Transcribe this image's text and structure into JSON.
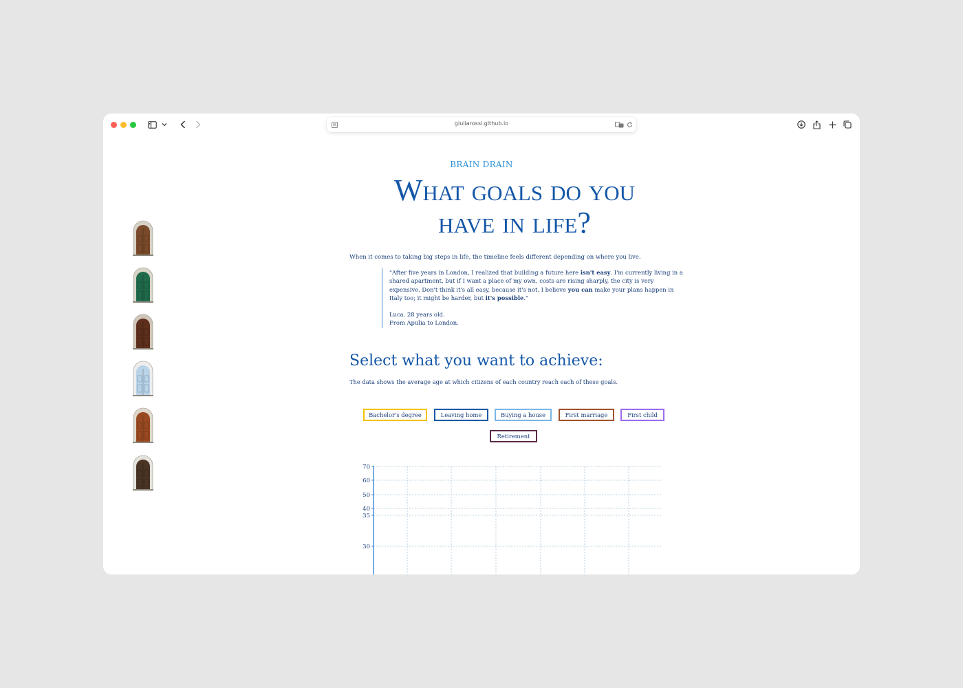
{
  "browser": {
    "url": "giuliarossi.github.io",
    "icons": [
      "sidebar-icon",
      "chevron-down-icon",
      "back-icon",
      "forward-icon",
      "reader-icon",
      "translate-icon",
      "reload-icon",
      "download-icon",
      "share-icon",
      "new-tab-icon",
      "tabs-overview-icon"
    ]
  },
  "page": {
    "kicker": "BRAIN DRAIN",
    "title_line1": "What goals do you",
    "title_line2": "have in life?",
    "intro": "When it comes to taking big steps in life, the timeline feels different depending on where you live.",
    "quote": {
      "t1": "\"After five years in London, I realized that building a future here ",
      "b1": "isn't easy",
      "t2": ". I'm currently living in a shared apartment, but if I want a place of my own, costs are rising sharply, the city is very expensive. Don't think it's all easy, because it's not. I believe ",
      "b2": "you can",
      "t3": " make your plans happen in Italy too; it might be harder, but ",
      "b3": "it's possible",
      "t4": ".\"",
      "attrib_name": "Luca. 28 years old.",
      "attrib_origin": "From Apulia to London."
    },
    "section_title": "Select what you want to achieve:",
    "section_sub": "The data shows the average age at which citizens of each country reach each of these goals."
  },
  "goals": [
    {
      "label": "Bachelor's degree",
      "color": "#f2c300"
    },
    {
      "label": "Leaving home",
      "color": "#1a5aa6"
    },
    {
      "label": "Buying a house",
      "color": "#7ab6e6"
    },
    {
      "label": "First marriage",
      "color": "#a0522d"
    },
    {
      "label": "First child",
      "color": "#9b6cf0"
    },
    {
      "label": "Retirement",
      "color": "#5a2a4a"
    }
  ],
  "doors": [
    {
      "name": "door-ornate-brown-icon",
      "frame": "#d6d2c8",
      "fill": "#7a4a2a"
    },
    {
      "name": "door-green-icon",
      "frame": "#d8d4c8",
      "fill": "#1f6a4a"
    },
    {
      "name": "door-dark-brown-icon",
      "frame": "#cfc6b8",
      "fill": "#5e2f1c"
    },
    {
      "name": "door-light-blue-icon",
      "frame": "#eeeeee",
      "fill": "#b9d3e8"
    },
    {
      "name": "door-orange-wood-icon",
      "frame": "#e0d8cc",
      "fill": "#9a4a22"
    },
    {
      "name": "door-stone-arch-icon",
      "frame": "#e4e2dc",
      "fill": "#4a3424"
    }
  ],
  "chart_data": {
    "type": "line",
    "title": "",
    "xlabel": "",
    "ylabel": "",
    "y_ticks": [
      70,
      60,
      50,
      40,
      35,
      30
    ],
    "grid": true,
    "series": []
  }
}
